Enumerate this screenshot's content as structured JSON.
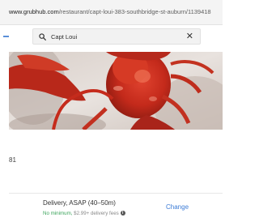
{
  "browser": {
    "url_host": "www.grubhub.com",
    "url_path": "/restaurant/capt-loui-383-southbridge-st-auburn/1139418"
  },
  "search": {
    "value": "Capt Loui"
  },
  "restaurant": {
    "left_number": "81"
  },
  "delivery": {
    "label": "Delivery, ASAP (40–50m)",
    "minimum": "No minimum,",
    "fee": " $2.99+ delivery fees",
    "change_label": "Change"
  },
  "colors": {
    "link": "#3b7bd6",
    "minimum_green": "#3aa35a"
  }
}
